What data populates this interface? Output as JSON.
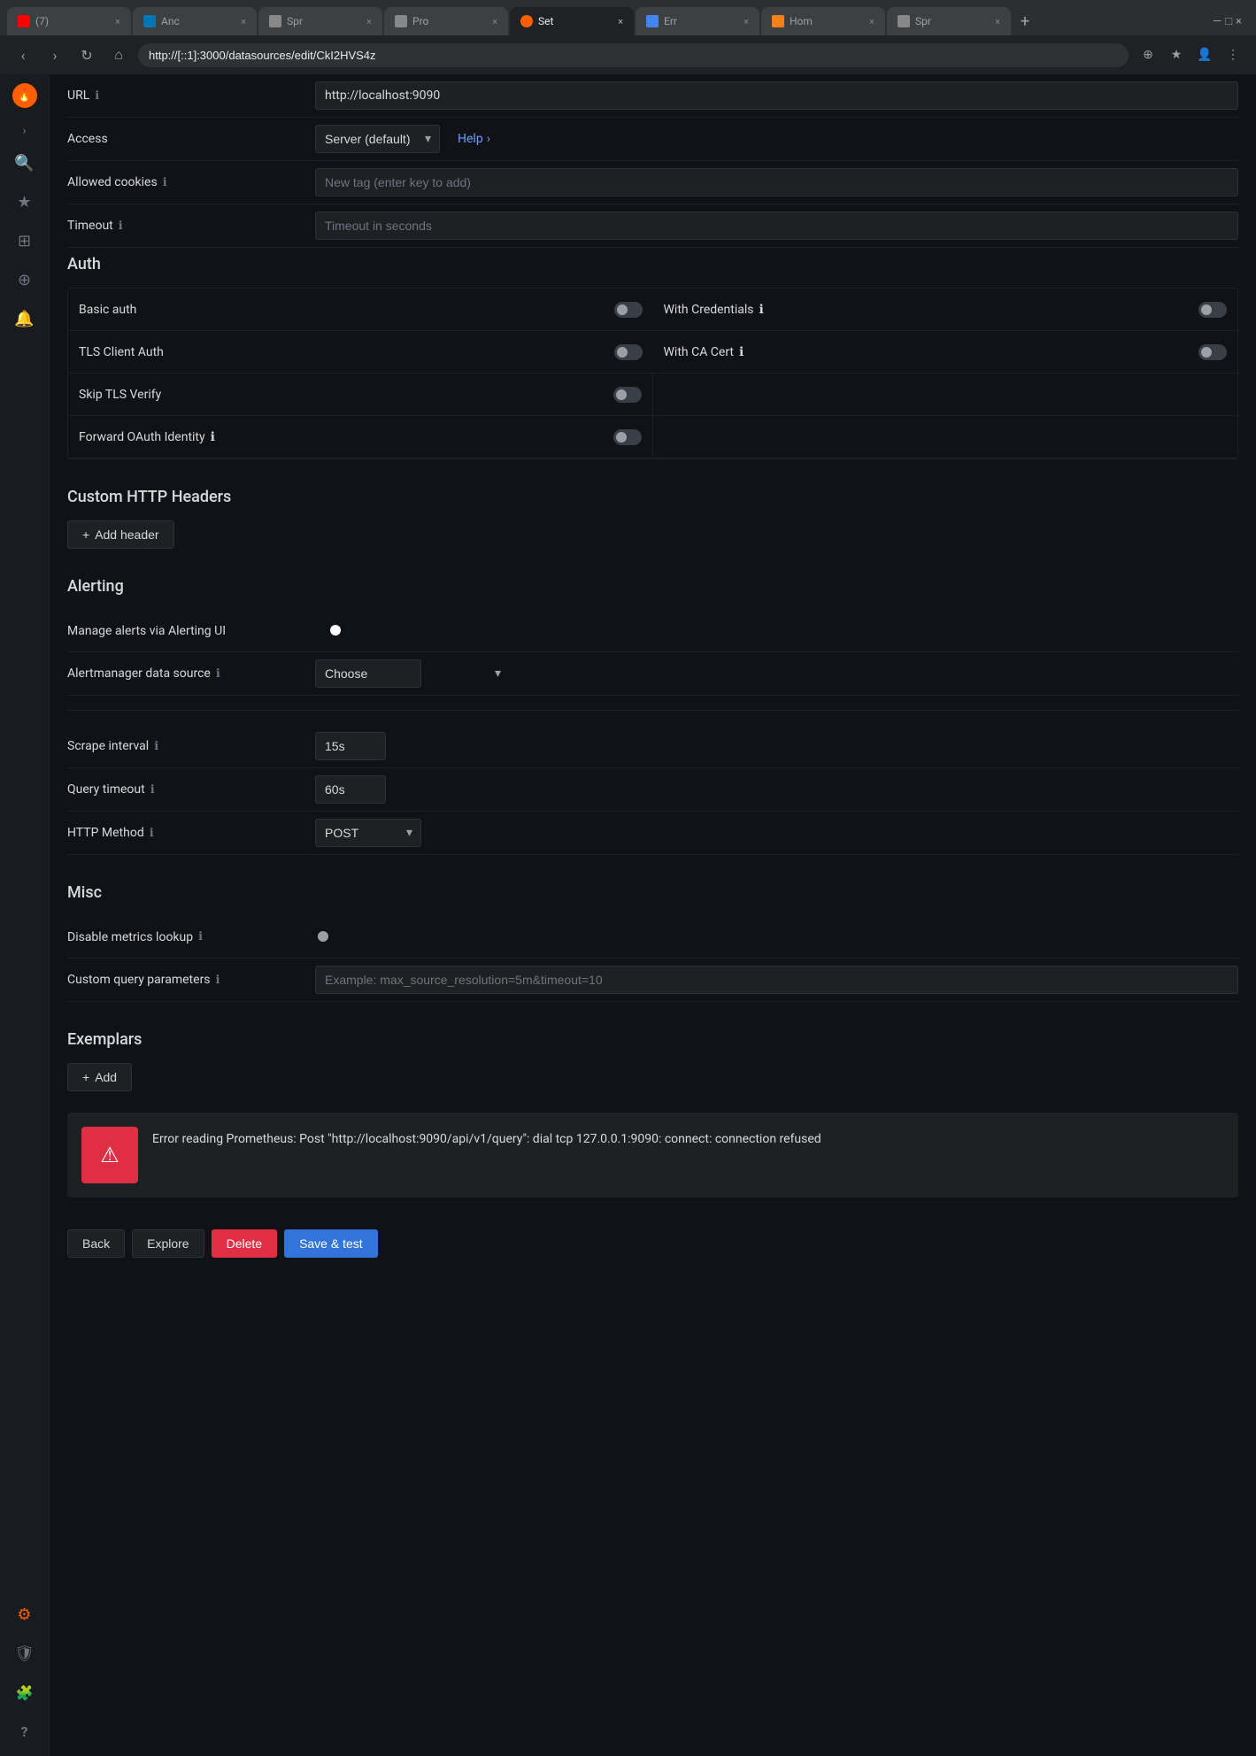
{
  "browser": {
    "tabs": [
      {
        "id": "yt",
        "label": "(7)",
        "favicon_color": "#ff0000",
        "active": false
      },
      {
        "id": "in",
        "label": "Anc",
        "favicon_color": "#0077b5",
        "active": false
      },
      {
        "id": "spr1",
        "label": "Spr",
        "favicon_color": "#888",
        "active": false
      },
      {
        "id": "pro",
        "label": "Pro",
        "favicon_color": "#888",
        "active": false
      },
      {
        "id": "set",
        "label": "Set",
        "favicon_color": "#ff5f00",
        "active": true
      },
      {
        "id": "err",
        "label": "Err",
        "favicon_color": "#4285f4",
        "active": false
      },
      {
        "id": "hom",
        "label": "Hom",
        "favicon_color": "#f4821f",
        "active": false
      },
      {
        "id": "spr2",
        "label": "Spr",
        "favicon_color": "#888",
        "active": false
      }
    ],
    "url": "http://[::1]:3000/datasources/edit/CkI2HVS4z"
  },
  "sidebar": {
    "logo": "G",
    "items": [
      {
        "id": "search",
        "icon": "🔍",
        "label": "Search"
      },
      {
        "id": "starred",
        "icon": "★",
        "label": "Starred"
      },
      {
        "id": "dashboards",
        "icon": "⊞",
        "label": "Dashboards"
      },
      {
        "id": "explore",
        "icon": "⊕",
        "label": "Explore"
      },
      {
        "id": "alerting",
        "icon": "🔔",
        "label": "Alerting"
      }
    ],
    "bottom": [
      {
        "id": "settings",
        "icon": "⚙",
        "label": "Settings",
        "active": true
      },
      {
        "id": "shield",
        "icon": "🛡",
        "label": "Shield"
      },
      {
        "id": "plugin",
        "icon": "🧩",
        "label": "Plugin"
      },
      {
        "id": "help",
        "icon": "?",
        "label": "Help"
      }
    ]
  },
  "form": {
    "url_label": "URL",
    "url_value": "http://localhost:9090",
    "access_label": "Access",
    "access_value": "Server (default)",
    "access_help": "Help",
    "allowed_cookies_label": "Allowed cookies",
    "allowed_cookies_placeholder": "New tag (enter key to add)",
    "timeout_label": "Timeout",
    "timeout_placeholder": "Timeout in seconds",
    "auth_title": "Auth",
    "basic_auth_label": "Basic auth",
    "tls_client_auth_label": "TLS Client Auth",
    "skip_tls_label": "Skip TLS Verify",
    "forward_oauth_label": "Forward OAuth Identity",
    "with_credentials_label": "With Credentials",
    "with_ca_cert_label": "With CA Cert",
    "custom_http_title": "Custom HTTP Headers",
    "add_header_label": "+ Add header",
    "alerting_title": "Alerting",
    "manage_alerts_label": "Manage alerts via Alerting UI",
    "alertmanager_label": "Alertmanager data source",
    "alertmanager_placeholder": "Choose",
    "scrape_interval_label": "Scrape interval",
    "scrape_interval_value": "15s",
    "query_timeout_label": "Query timeout",
    "query_timeout_value": "60s",
    "http_method_label": "HTTP Method",
    "http_method_value": "POST",
    "misc_title": "Misc",
    "disable_metrics_label": "Disable metrics lookup",
    "custom_query_label": "Custom query parameters",
    "custom_query_placeholder": "Example: max_source_resolution=5m&timeout=10",
    "exemplars_title": "Exemplars",
    "add_exemplar_label": "+ Add",
    "error_message": "Error reading Prometheus: Post \"http://localhost:9090/api/v1/query\": dial tcp 127.0.0.1:9090: connect: connection refused",
    "back_label": "Back",
    "explore_label": "Explore",
    "delete_label": "Delete",
    "save_test_label": "Save & test"
  },
  "icons": {
    "info": "ℹ",
    "chevron_down": "▾",
    "chevron_right": "›",
    "plus": "+",
    "warning": "⚠"
  }
}
